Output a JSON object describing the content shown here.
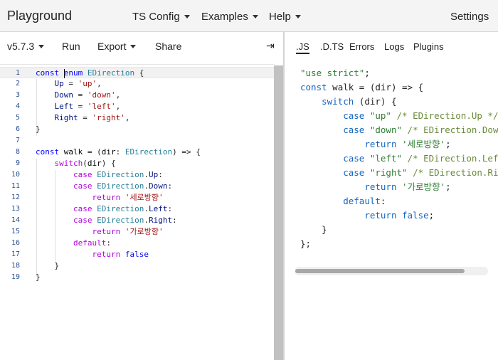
{
  "nav": {
    "brand": "Playground",
    "items": [
      "TS Config",
      "Examples",
      "Help"
    ],
    "settings": "Settings"
  },
  "toolbar": {
    "version": "v5.7.3",
    "run": "Run",
    "export": "Export",
    "share": "Share",
    "collapse_icon": "⇥"
  },
  "editor": {
    "line_numbers": [
      "1",
      "2",
      "3",
      "4",
      "5",
      "6",
      "7",
      "8",
      "9",
      "10",
      "11",
      "12",
      "13",
      "14",
      "15",
      "16",
      "17",
      "18",
      "19"
    ]
  },
  "output": {
    "tabs": [
      ".JS",
      ".D.TS",
      "Errors",
      "Logs",
      "Plugins"
    ],
    "active_tab": ".JS"
  },
  "colors": {
    "keyword": "#0000ff",
    "control": "#af00db",
    "type": "#267f99",
    "string": "#a31515",
    "output_string": "#2e7d32",
    "output_keyword": "#1565c0",
    "line_number": "#2b4f8f"
  }
}
